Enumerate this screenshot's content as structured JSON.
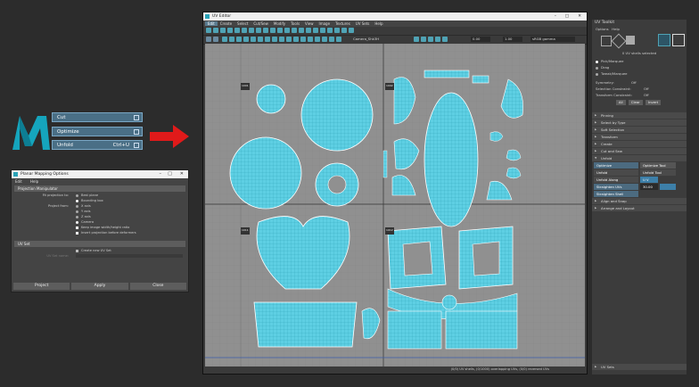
{
  "colors": {
    "accent": "#2aa3b8",
    "arrow": "#e01a1a",
    "uv_shell": "#5ecfe3",
    "grid_bg": "#909090"
  },
  "mini_menu": [
    {
      "label": "Cut",
      "shortcut": ""
    },
    {
      "label": "Optimize",
      "shortcut": ""
    },
    {
      "label": "Unfold",
      "shortcut": "Ctrl+U"
    }
  ],
  "dialog": {
    "title": "Planar Mapping Options",
    "menu": [
      "Edit",
      "Help"
    ],
    "section1": "Projection Manipulator",
    "fit_label": "Fit projection to:",
    "fit_opt1": "Best plane",
    "fit_opt2": "Bounding box",
    "project_from_label": "Project from:",
    "axes": [
      "X axis",
      "Y axis",
      "Z axis",
      "Camera"
    ],
    "keep_ratio": "Keep image width/height ratio",
    "insert_before": "Insert projection before deformers",
    "section2": "UV Set",
    "create_new": "Create new UV Set",
    "uvset_name_label": "UV Set name:",
    "buttons": [
      "Project",
      "Apply",
      "Close"
    ]
  },
  "uv_editor": {
    "title": "UV Editor",
    "menu": [
      "Edit",
      "Create",
      "Select",
      "Cut/Sew",
      "Modify",
      "Tools",
      "View",
      "Image",
      "Textures",
      "UV Sets",
      "Help"
    ],
    "camera": "Camera_Shk3H",
    "field1": "0.00",
    "field2": "1.00",
    "display_mode": "sRGB gamma",
    "tiles": [
      "1001",
      "1002",
      "1011",
      "1012"
    ],
    "status": "(0/0) UV shells, (0/1000) overlapping UVs, (0/0) reversed UVs"
  },
  "toolkit": {
    "title": "UV Toolkit",
    "menu": [
      "Options",
      "Help"
    ],
    "selected_info": "0 UV shells selected",
    "pick_options": [
      "Pick/Marquee",
      "Drag",
      "Tweak/Marquee"
    ],
    "symmetry_label": "Symmetry:",
    "symmetry_value": "Off",
    "sel_constraint_label": "Selection Constraint:",
    "sel_constraint_value": "Off",
    "trans_constraint_label": "Transform Constraint:",
    "trans_constraint_value": "Off",
    "btns": [
      "All",
      "Clear",
      "Invert"
    ],
    "sections": [
      "Pinning",
      "Select by Type",
      "Soft Selection",
      "Transform",
      "Create",
      "Cut and Sew",
      "Unfold"
    ],
    "unfold_tools": [
      {
        "left": "Optimize",
        "right": "Optimize Tool"
      },
      {
        "left": "Unfold",
        "right": "Unfold Tool"
      },
      {
        "left": "Unfold Along",
        "right": "U  V"
      },
      {
        "left": "Straighten UVs",
        "right": "30.00"
      },
      {
        "left": "Straighten Shell",
        "right": ""
      }
    ],
    "sections2": [
      "Align and Snap",
      "Arrange and Layout"
    ],
    "bottom_section": "UV Sets"
  }
}
